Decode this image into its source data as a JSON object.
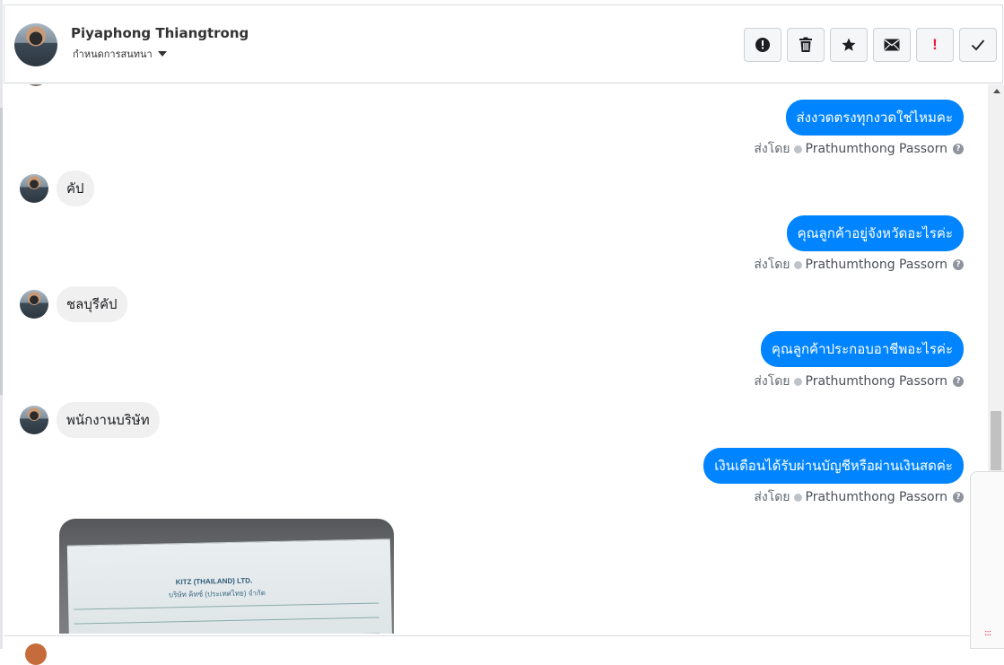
{
  "header": {
    "contact_name": "Piyaphong Thiangtrong",
    "conversation_setting": "กำหนดการสนทนา",
    "actions": [
      {
        "name": "mark-spam",
        "icon": "exclamation-circle-icon"
      },
      {
        "name": "delete",
        "icon": "trash-icon"
      },
      {
        "name": "star",
        "icon": "star-icon"
      },
      {
        "name": "mark-unread",
        "icon": "envelope-icon"
      },
      {
        "name": "important",
        "icon": "red-exclamation-icon",
        "label": "!"
      },
      {
        "name": "mark-done",
        "icon": "checkmark-icon"
      }
    ]
  },
  "messages": [
    {
      "direction": "out",
      "text": "ส่งงวดตรงทุกงวดใช่ไหมคะ",
      "sent_prefix": "ส่งโดย",
      "author": "Prathumthong Passorn"
    },
    {
      "direction": "in",
      "text": "คัป"
    },
    {
      "direction": "out",
      "text": "คุณลูกค้าอยู่จังหวัดอะไรค่ะ",
      "sent_prefix": "ส่งโดย",
      "author": "Prathumthong Passorn"
    },
    {
      "direction": "in",
      "text": "ชลบุรีคัป"
    },
    {
      "direction": "out",
      "text": "คุณลูกค้าประกอบอาชีพอะไรค่ะ",
      "sent_prefix": "ส่งโดย",
      "author": "Prathumthong Passorn"
    },
    {
      "direction": "in",
      "text": "พนักงานบริษัท"
    },
    {
      "direction": "out",
      "text": "เงินเดือนได้รับผ่านบัญชีหรือผ่านเงินสดค่ะ",
      "sent_prefix": "ส่งโดย",
      "author": "Prathumthong Passorn"
    }
  ],
  "attachment": {
    "company_text": "KITZ (THAILAND) LTD.",
    "company_sub": "บริษัท คิทซ์ (ประเทศไทย) จำกัด"
  },
  "colors": {
    "outgoing_bubble": "#0084ff",
    "incoming_bubble": "#f0f0f0",
    "important_red": "#e41e3f"
  }
}
